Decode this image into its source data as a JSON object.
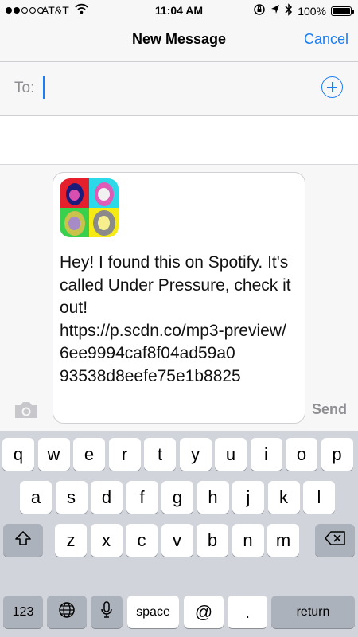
{
  "status_bar": {
    "carrier": "AT&T",
    "time": "11:04 AM",
    "battery": "100%",
    "battery_level": 1.0,
    "signal_bars": 2
  },
  "nav": {
    "title": "New Message",
    "cancel_label": "Cancel"
  },
  "recipient": {
    "label": "To:",
    "value": "",
    "add_icon": "plus-circle-icon"
  },
  "composer": {
    "camera_icon": "camera-icon",
    "attachment": "album-art-thumbnail",
    "message_text": "Hey! I found this on Spotify. It's called Under Pressure, check it out!\nhttps://p.scdn.co/mp3-preview/\n6ee9994caf8f04ad59a0\n93538d8eefe75e1b8825",
    "send_label": "Send"
  },
  "keyboard": {
    "row1": [
      "q",
      "w",
      "e",
      "r",
      "t",
      "y",
      "u",
      "i",
      "o",
      "p"
    ],
    "row2": [
      "a",
      "s",
      "d",
      "f",
      "g",
      "h",
      "j",
      "k",
      "l"
    ],
    "row3": [
      "z",
      "x",
      "c",
      "v",
      "b",
      "n",
      "m"
    ],
    "shift_icon": "shift-icon",
    "delete_icon": "delete-icon",
    "numbers_label": "123",
    "globe_icon": "globe-icon",
    "mic_icon": "microphone-icon",
    "space_label": "space",
    "at_label": "@",
    "dot_label": ".",
    "return_label": "return"
  },
  "colors": {
    "accent": "#1a7ef5",
    "keyboard_bg": "#d1d4da",
    "function_key": "#acb2bc"
  }
}
